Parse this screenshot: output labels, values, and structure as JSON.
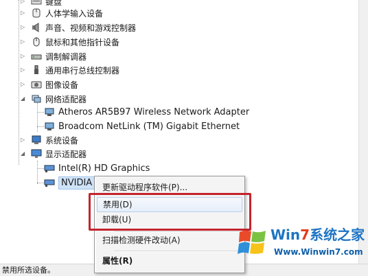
{
  "tree": {
    "categories": [
      {
        "label": "键盘",
        "icon": "keyboard-icon"
      },
      {
        "label": "人体学输入设备",
        "icon": "hid-icon"
      },
      {
        "label": "声音、视频和游戏控制器",
        "icon": "sound-icon"
      },
      {
        "label": "鼠标和其他指针设备",
        "icon": "mouse-icon"
      },
      {
        "label": "调制解调器",
        "icon": "modem-icon"
      },
      {
        "label": "通用串行总线控制器",
        "icon": "usb-icon"
      },
      {
        "label": "图像设备",
        "icon": "camera-icon"
      },
      {
        "label": "网络适配器",
        "icon": "network-icon"
      },
      {
        "label": "系统设备",
        "icon": "system-icon"
      },
      {
        "label": "显示适配器",
        "icon": "display-icon"
      }
    ],
    "network_children": [
      {
        "label": "Atheros AR5B97 Wireless Network Adapter",
        "icon": "network-adapter-icon"
      },
      {
        "label": "Broadcom NetLink (TM) Gigabit Ethernet",
        "icon": "network-adapter-icon"
      }
    ],
    "display_children": [
      {
        "label": "Intel(R) HD Graphics",
        "icon": "display-adapter-icon"
      },
      {
        "label": "NVIDIA G",
        "icon": "display-adapter-icon"
      }
    ]
  },
  "context_menu": {
    "items": [
      {
        "label": "更新驱动程序软件(P)..."
      },
      {
        "label": "禁用(D)"
      },
      {
        "label": "卸载(U)"
      },
      {
        "label": "扫描检测硬件改动(A)"
      },
      {
        "label": "属性(R)"
      }
    ]
  },
  "status_bar": {
    "text": "禁用所选设备。"
  },
  "watermark": {
    "brand_prefix": "Win",
    "brand_seven": "7",
    "brand_suffix": "系统之家",
    "url": "Www.Winwin7.com"
  },
  "colors": {
    "highlight_box": "#c4232d",
    "menu_background": "#f4f4f4",
    "selection": "#cfe3f8",
    "watermark_blue": "#1e74c4"
  }
}
